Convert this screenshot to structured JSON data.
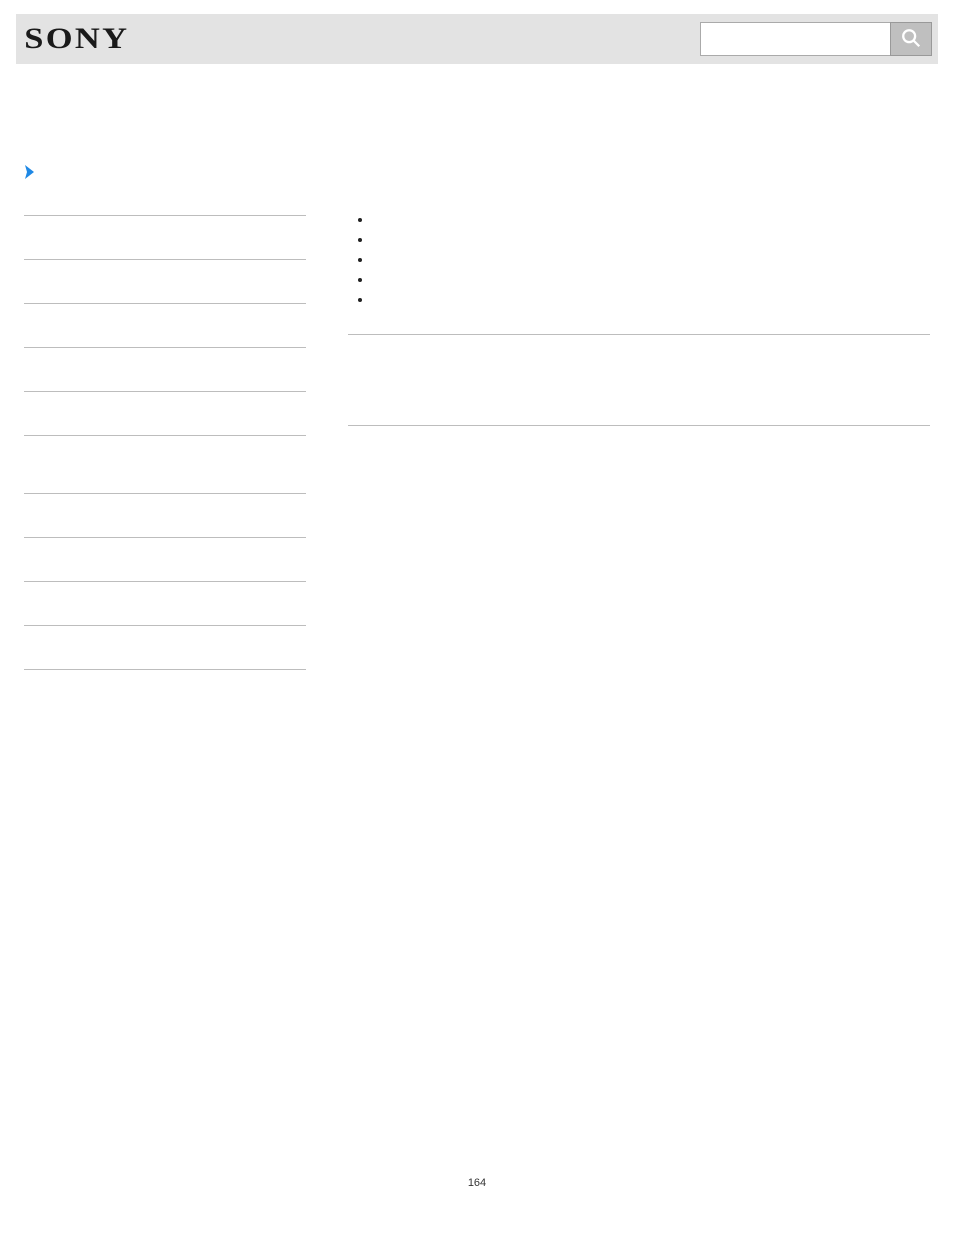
{
  "header": {
    "logo_text": "SONY",
    "search_placeholder": ""
  },
  "sidebar": {
    "items": [
      {
        "label": ""
      },
      {
        "label": ""
      },
      {
        "label": ""
      },
      {
        "label": ""
      },
      {
        "label": ""
      },
      {
        "label": ""
      },
      {
        "label": ""
      },
      {
        "label": ""
      },
      {
        "label": ""
      },
      {
        "label": ""
      },
      {
        "label": ""
      }
    ]
  },
  "main": {
    "bullets": [
      {
        "text": ""
      },
      {
        "text": ""
      },
      {
        "text": ""
      },
      {
        "text": ""
      },
      {
        "text": ""
      }
    ]
  },
  "page_number": "164"
}
